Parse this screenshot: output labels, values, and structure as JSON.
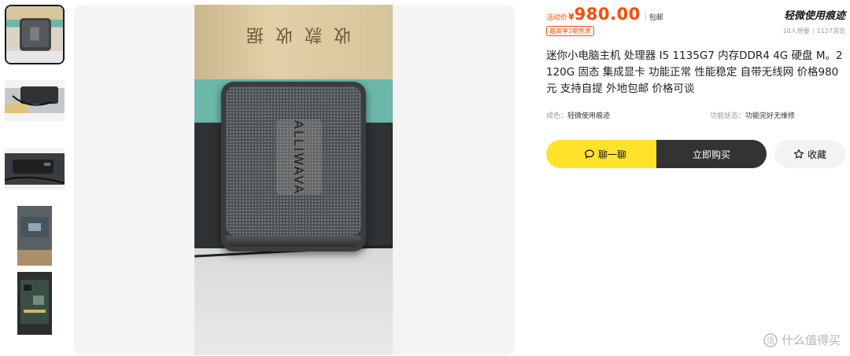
{
  "gallery": {
    "thumbnails": [
      {
        "label": "",
        "scene": "device-on-desk"
      },
      {
        "label": "",
        "scene": "device-rear-cables"
      },
      {
        "label": "",
        "scene": "device-ports-side"
      },
      {
        "label": "",
        "scene": "device-label-sticker"
      },
      {
        "label": "",
        "scene": "device-open-internals"
      }
    ],
    "main_image": {
      "paper_text": "收 款 收 据",
      "device_logo": "ALLIWAVA"
    }
  },
  "product": {
    "activity_label": "活动价",
    "currency_symbol": "¥",
    "price": "980.00",
    "shipping": "包邮",
    "installment_tag": "最高享3期免息",
    "condition_badge": "轻微使用痕迹",
    "wants": "10人想要",
    "views": "1127浏览",
    "title": "迷你小电脑主机 处理器 I5 1135G7 内存DDR4 4G 硬盘 M。2 120G 固态 集成显卡 功能正常 性能稳定 自带无线网 价格980元 支持自提 外地包邮 价格可谈",
    "attributes": [
      {
        "key": "成色：",
        "value": "轻微使用痕迹"
      },
      {
        "key": "功能状态：",
        "value": "功能完好无维修"
      }
    ]
  },
  "actions": {
    "chat_label": "聊一聊",
    "buy_label": "立即购买",
    "favorite_label": "收藏"
  },
  "watermark": {
    "text": "什么值得买"
  },
  "colors": {
    "accent_price": "#ff4a00",
    "chat_button": "#ffe32b",
    "buy_button": "#333333"
  }
}
